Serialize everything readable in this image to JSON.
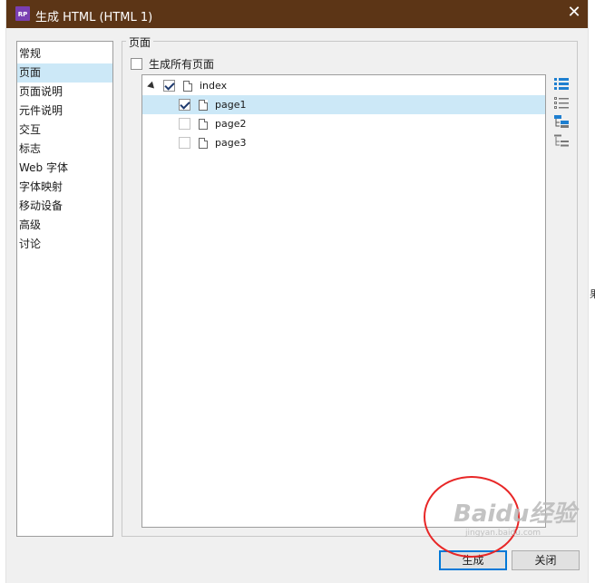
{
  "window": {
    "title": "生成 HTML (HTML 1)",
    "app_icon_text": "RP",
    "close_glyph": "✕"
  },
  "background": {
    "right_edge_text": "果"
  },
  "nav": {
    "items": [
      {
        "label": "常规",
        "selected": false
      },
      {
        "label": "页面",
        "selected": true
      },
      {
        "label": "页面说明",
        "selected": false
      },
      {
        "label": "元件说明",
        "selected": false
      },
      {
        "label": "交互",
        "selected": false
      },
      {
        "label": "标志",
        "selected": false
      },
      {
        "label": "Web 字体",
        "selected": false
      },
      {
        "label": "字体映射",
        "selected": false
      },
      {
        "label": "移动设备",
        "selected": false
      },
      {
        "label": "高级",
        "selected": false
      },
      {
        "label": "讨论",
        "selected": false
      }
    ]
  },
  "pages_panel": {
    "group_label": "页面",
    "generate_all_label": "生成所有页面",
    "generate_all_checked": false,
    "tree": [
      {
        "label": "index",
        "level": 0,
        "checked": true,
        "selected": false,
        "expanded": true
      },
      {
        "label": "page1",
        "level": 1,
        "checked": true,
        "selected": true
      },
      {
        "label": "page2",
        "level": 1,
        "checked": false,
        "selected": false
      },
      {
        "label": "page3",
        "level": 1,
        "checked": false,
        "selected": false
      }
    ],
    "tools": [
      "check-all-icon",
      "uncheck-all-icon",
      "check-children-icon",
      "uncheck-children-icon"
    ]
  },
  "footer": {
    "generate_label": "生成",
    "close_label": "关闭"
  },
  "watermark": {
    "text": "Baidu经验",
    "sub": "jingyan.baidu.com"
  },
  "colors": {
    "titlebar": "#5c3516",
    "selection": "#cce8f7",
    "annotation": "#e82727",
    "icon_blue": "#1e7fd0"
  }
}
